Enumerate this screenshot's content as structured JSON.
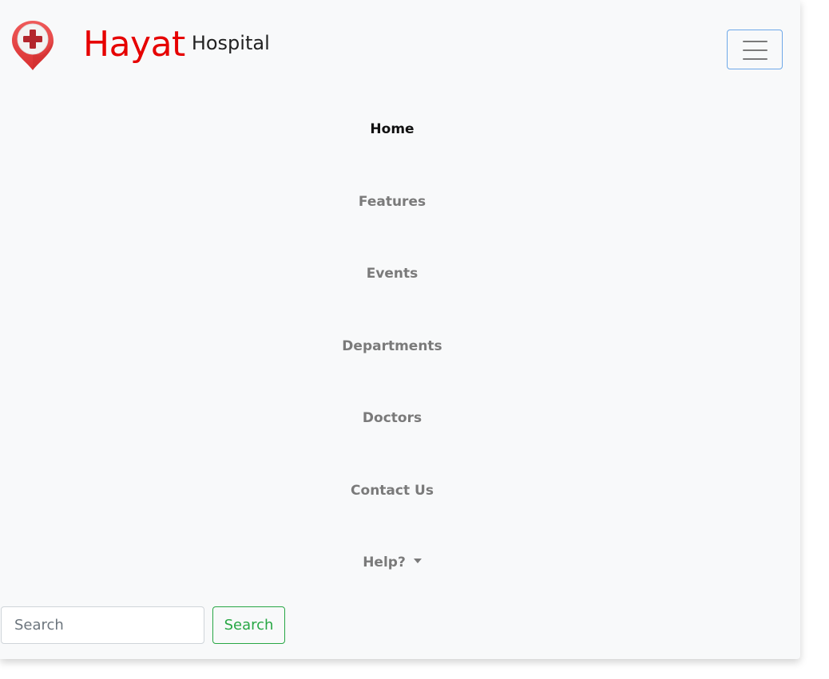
{
  "brand": {
    "name": "Hayat",
    "subtitle": "Hospital",
    "logo_icon": "location-pin-medical-cross-icon",
    "name_color": "#e60000"
  },
  "toggler": {
    "icon": "hamburger-menu-icon",
    "border_color": "#6ea8e8"
  },
  "nav": {
    "items": [
      {
        "label": "Home",
        "active": true
      },
      {
        "label": "Features",
        "active": false
      },
      {
        "label": "Events",
        "active": false
      },
      {
        "label": "Departments",
        "active": false
      },
      {
        "label": "Doctors",
        "active": false
      },
      {
        "label": "Contact Us",
        "active": false
      },
      {
        "label": "Help?",
        "active": false,
        "dropdown": true,
        "dropdown_icon": "caret-down-icon"
      }
    ]
  },
  "search": {
    "placeholder": "Search",
    "value": "",
    "button_label": "Search",
    "button_color": "#28a745"
  },
  "colors": {
    "navbar_background": "#f8f9fa",
    "nav_link": "#7a7a7a",
    "nav_link_active": "#111111"
  }
}
